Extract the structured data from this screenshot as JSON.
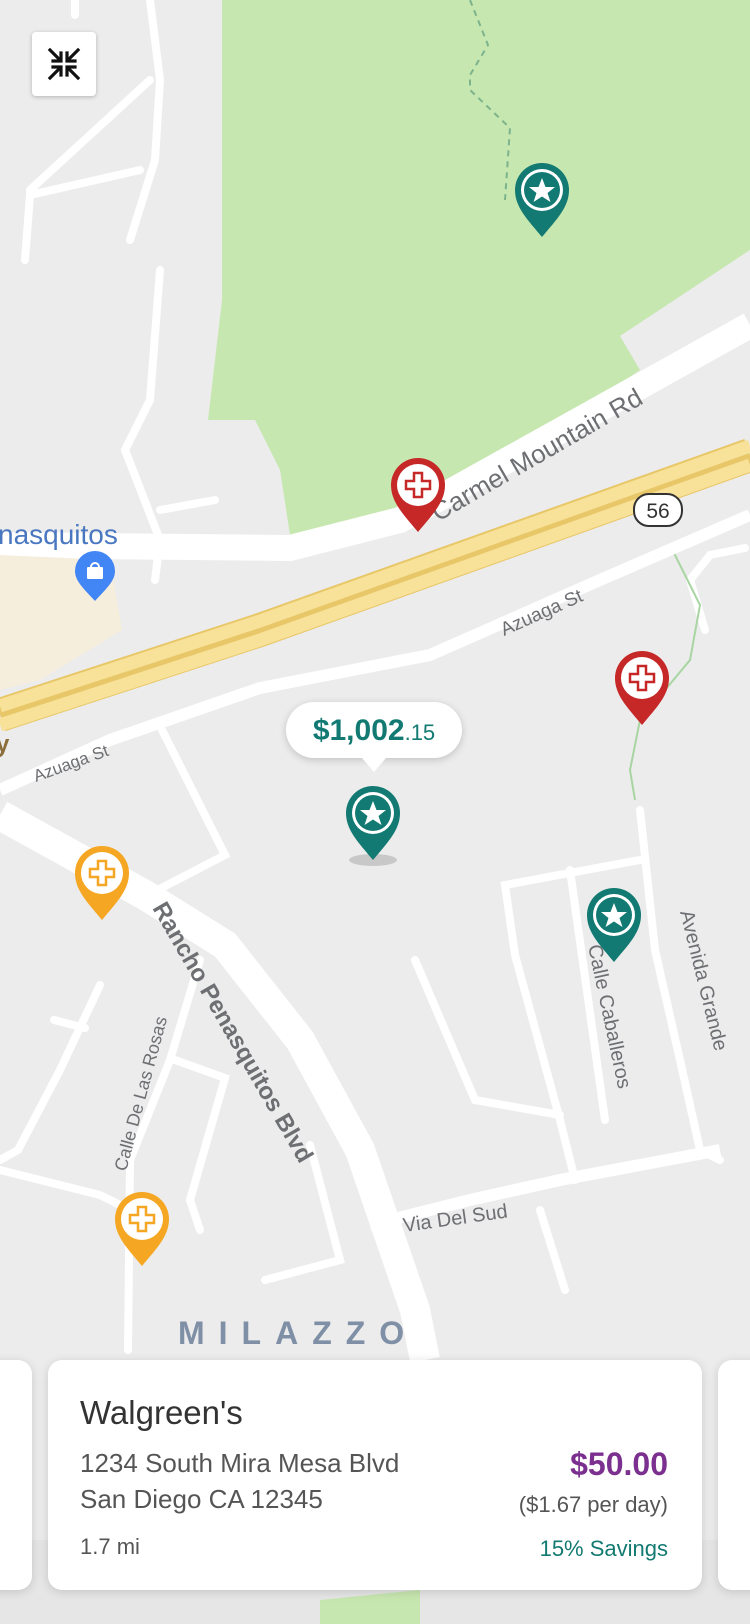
{
  "map": {
    "district_label": "MILAZZO",
    "poi_partial_label": "nasquitos",
    "highway_shield": "56",
    "left_edge_fragment": "y",
    "streets": {
      "carmel_mountain": "Carmel Mountain Rd",
      "azuaga_right": "Azuaga St",
      "azuaga_left": "Azuaga St",
      "rancho_penasquitos": "Rancho Penasquitos Blvd",
      "calle_de_las_rosas": "Calle De Las Rosas",
      "calle_caballeros": "Calle Caballeros",
      "avenida_grande": "Avenida Grande",
      "via_del_sud": "Via Del Sud"
    },
    "colors": {
      "background": "#ececec",
      "park": "#c7e7b0",
      "road": "#ffffff",
      "highway": "#f8e29a",
      "highway_edge": "#e8c769",
      "label": "#6d6f73",
      "poi_blue": "#4285f4",
      "pin_teal": "#127a72",
      "pin_red": "#c62828",
      "pin_orange": "#f5a623"
    }
  },
  "selected_marker": {
    "price_main": "$1,002",
    "price_cents": ".15"
  },
  "pins": [
    {
      "type": "star-pin",
      "color": "teal"
    },
    {
      "type": "cross-pin",
      "color": "red"
    },
    {
      "type": "cross-pin",
      "color": "red"
    },
    {
      "type": "star-pin",
      "color": "teal",
      "selected": true
    },
    {
      "type": "cross-pin",
      "color": "orange"
    },
    {
      "type": "star-pin",
      "color": "teal"
    },
    {
      "type": "cross-pin",
      "color": "orange"
    }
  ],
  "controls": {
    "collapse_icon": "collapse-arrows-icon"
  },
  "card": {
    "name": "Walgreen's",
    "address_line1": "1234 South Mira Mesa Blvd",
    "address_line2": "San Diego CA 12345",
    "distance": "1.7 mi",
    "price": "$50.00",
    "per_day": "($1.67 per day)",
    "savings": "15% Savings"
  }
}
